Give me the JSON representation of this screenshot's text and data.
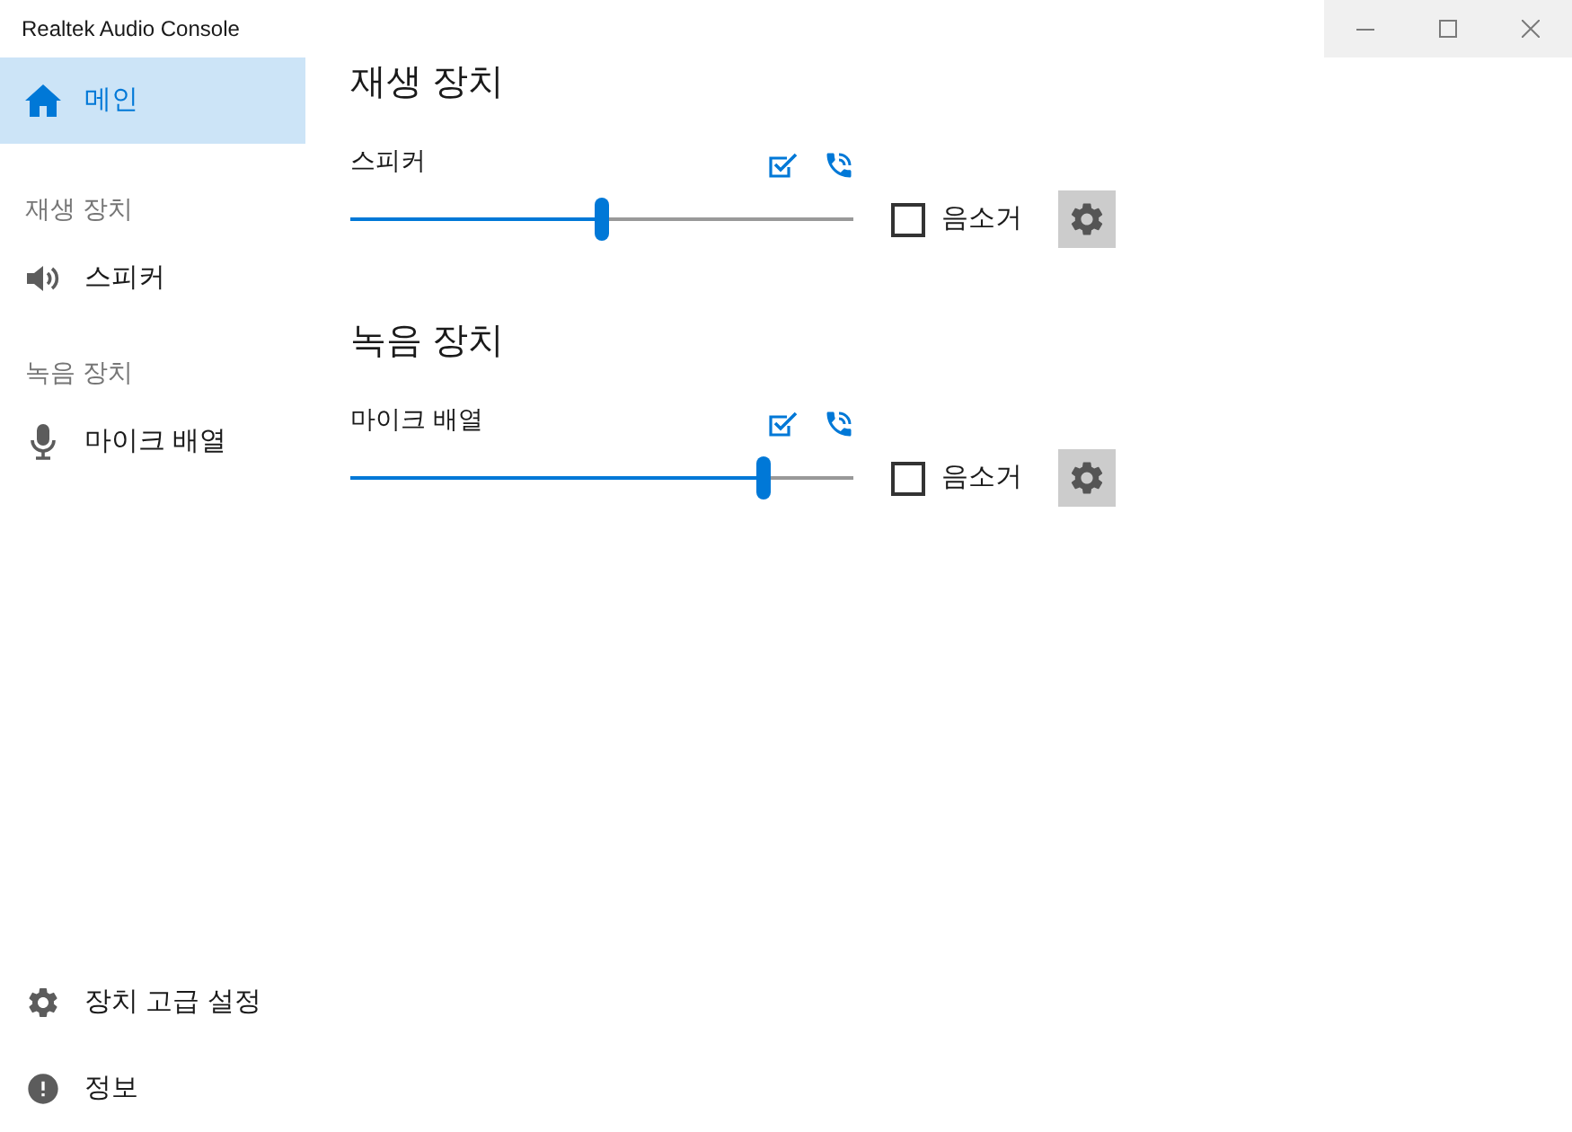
{
  "window": {
    "title": "Realtek Audio Console"
  },
  "sidebar": {
    "main": {
      "label": "메인",
      "selected": true
    },
    "groups": [
      {
        "heading": "재생 장치",
        "items": [
          {
            "label": "스피커",
            "selected": false
          }
        ]
      },
      {
        "heading": "녹음 장치",
        "items": [
          {
            "label": "마이크 배열",
            "selected": false
          }
        ]
      }
    ],
    "footer": [
      {
        "label": "장치 고급 설정",
        "selected": false
      },
      {
        "label": "정보",
        "selected": false
      }
    ]
  },
  "sections": [
    {
      "title": "재생 장치",
      "devices": [
        {
          "name": "스피커",
          "level": 0.5,
          "muted": false,
          "mute_label": "음소거"
        }
      ]
    },
    {
      "title": "녹음 장치",
      "devices": [
        {
          "name": "마이크 배열",
          "level": 0.82,
          "muted": false,
          "mute_label": "음소거"
        }
      ]
    }
  ]
}
